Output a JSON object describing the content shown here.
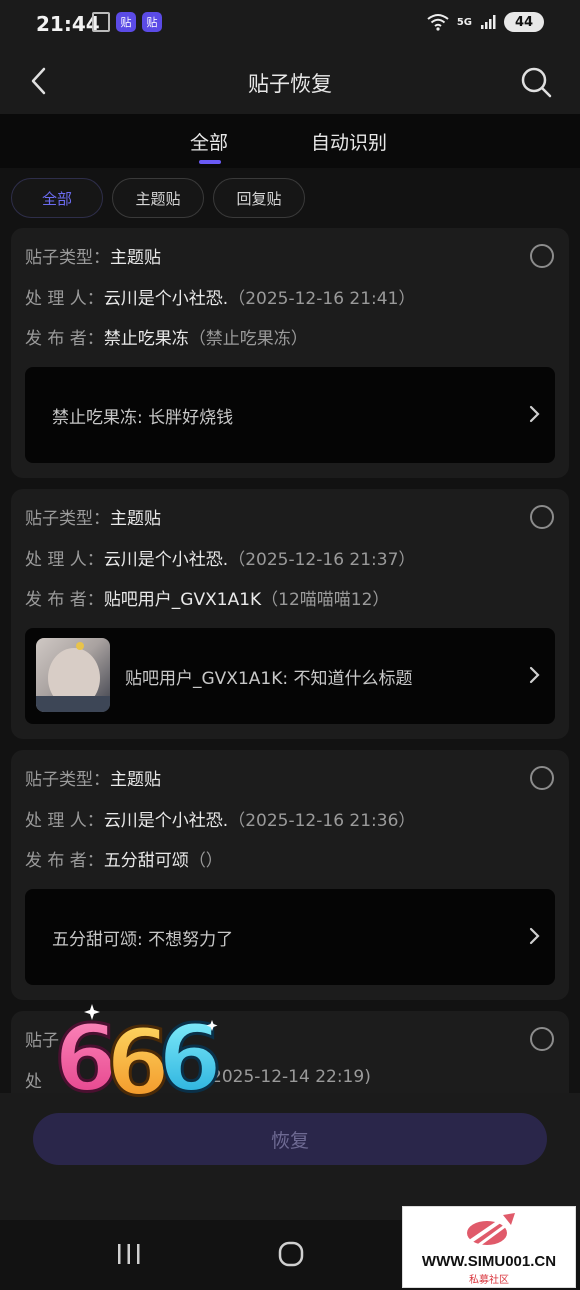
{
  "status_bar": {
    "time": "21:44",
    "app_badge": "贴",
    "network": "5G",
    "battery": "44"
  },
  "header": {
    "title": "贴子恢复"
  },
  "tabs": [
    {
      "label": "全部"
    },
    {
      "label": "自动识别"
    }
  ],
  "filters": [
    {
      "label": "全部"
    },
    {
      "label": "主题贴"
    },
    {
      "label": "回复贴"
    }
  ],
  "labels": {
    "type": "贴子类型：",
    "handler": "处 理 人：",
    "publisher": "发 布 者："
  },
  "posts": [
    {
      "type": "主题贴",
      "handler": "云川是个小社恐.",
      "handler_time": "（2025-12-16 21:41）",
      "publisher": "禁止吃果冻",
      "publisher_sub": "（禁止吃果冻）",
      "preview": "禁止吃果冻: 长胖好烧钱"
    },
    {
      "type": "主题贴",
      "handler": "云川是个小社恐.",
      "handler_time": "（2025-12-16 21:37）",
      "publisher": "贴吧用户_GVX1A1K",
      "publisher_sub": "（12喵喵喵12）",
      "preview": "贴吧用户_GVX1A1K: 不知道什么标题"
    },
    {
      "type": "主题贴",
      "handler": "云川是个小社恐.",
      "handler_time": "（2025-12-16 21:36）",
      "publisher": "五分甜可颂",
      "publisher_sub": "（）",
      "preview": "五分甜可颂: 不想努力了"
    },
    {
      "type_partial": "贴子",
      "handler_partial": "处",
      "handler_time_partial": "2025-12-14 22:19)"
    }
  ],
  "restore_button": {
    "label": "恢复"
  },
  "sticker": {
    "text": "666"
  },
  "watermark": {
    "main": "WWW.SIMU001.CN",
    "sub": "私募社区"
  },
  "colors": {
    "accent": "#6a5af5",
    "background": "#121212",
    "card": "#1c1c1c"
  }
}
